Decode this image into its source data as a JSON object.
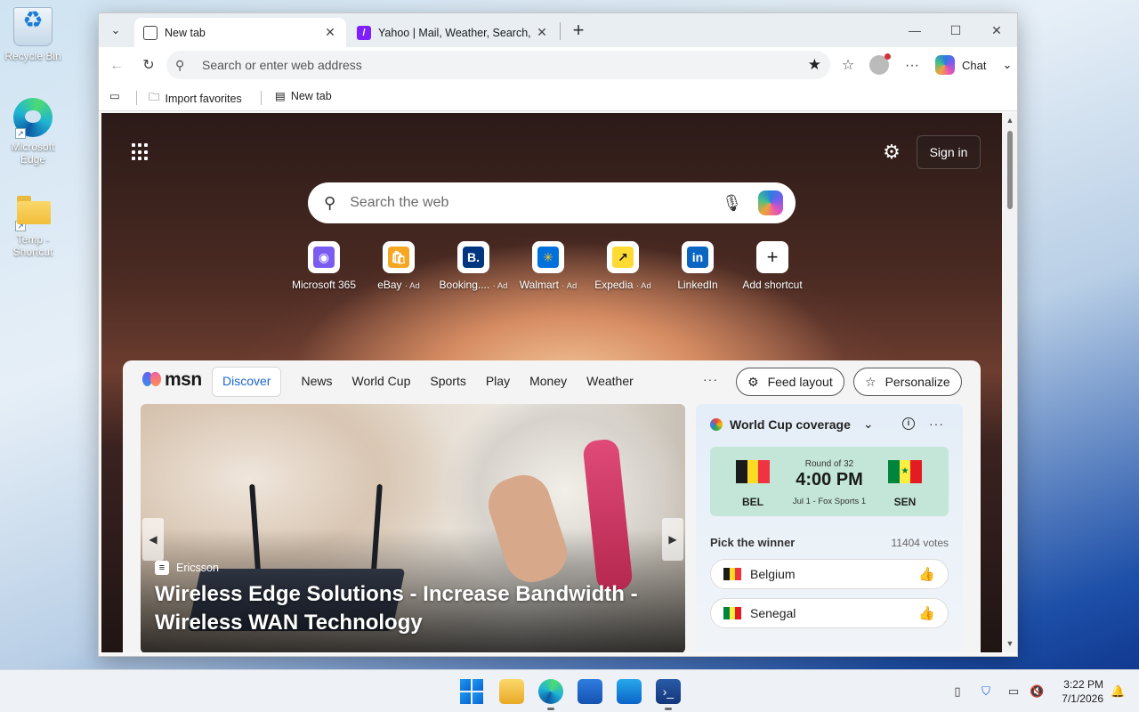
{
  "desktop": {
    "icons": [
      {
        "label": "Recycle Bin",
        "icon": "recycle-bin-icon"
      },
      {
        "label": "Microsoft Edge",
        "icon": "edge-icon"
      },
      {
        "label": "Temp - Shortcut",
        "icon": "folder-icon"
      }
    ]
  },
  "browser": {
    "tabs": [
      {
        "title": "New tab",
        "icon": "new-tab-page-icon",
        "active": true
      },
      {
        "title": "Yahoo | Mail, Weather, Search, Poli",
        "icon": "yahoo-icon",
        "active": false
      }
    ],
    "address_placeholder": "Search or enter web address",
    "chat_label": "Chat",
    "favorites": [
      {
        "label": "Import favorites",
        "icon": "import-icon"
      },
      {
        "label": "New tab",
        "icon": "page-icon"
      }
    ]
  },
  "page": {
    "sign_in": "Sign in",
    "search_placeholder": "Search the web",
    "shortcuts": [
      {
        "label": "Microsoft 365",
        "ad": "",
        "color": "#7b5cf0",
        "glyph": "◉"
      },
      {
        "label": "eBay",
        "ad": "· Ad",
        "color": "#e53238",
        "glyph": "🛍"
      },
      {
        "label": "Booking....",
        "ad": "· Ad",
        "color": "#003580",
        "glyph": "B."
      },
      {
        "label": "Walmart",
        "ad": "· Ad",
        "color": "#0071dc",
        "glyph": "✳"
      },
      {
        "label": "Expedia",
        "ad": "· Ad",
        "color": "#fddb32",
        "glyph": "↗"
      },
      {
        "label": "LinkedIn",
        "ad": "",
        "color": "#0a66c2",
        "glyph": "in"
      },
      {
        "label": "Add shortcut",
        "ad": "",
        "color": "#ffffff",
        "glyph": "+"
      }
    ]
  },
  "feed": {
    "logo_text": "msn",
    "nav": [
      "Discover",
      "News",
      "World Cup",
      "Sports",
      "Play",
      "Money",
      "Weather"
    ],
    "more": "···",
    "feed_layout": "Feed layout",
    "personalize": "Personalize",
    "hero": {
      "source": "Ericsson",
      "title": "Wireless Edge Solutions - Increase Bandwidth - Wireless WAN Technology"
    },
    "world_cup": {
      "title": "World Cup coverage",
      "round": "Round of 32",
      "time": "4:00 PM",
      "meta": "Jul 1 - Fox Sports 1",
      "home": "BEL",
      "away": "SEN",
      "pick_label": "Pick the winner",
      "votes": "11404 votes",
      "options": [
        "Belgium",
        "Senegal"
      ]
    }
  },
  "taskbar": {
    "time": "3:22 PM",
    "date": "7/1/2026"
  }
}
